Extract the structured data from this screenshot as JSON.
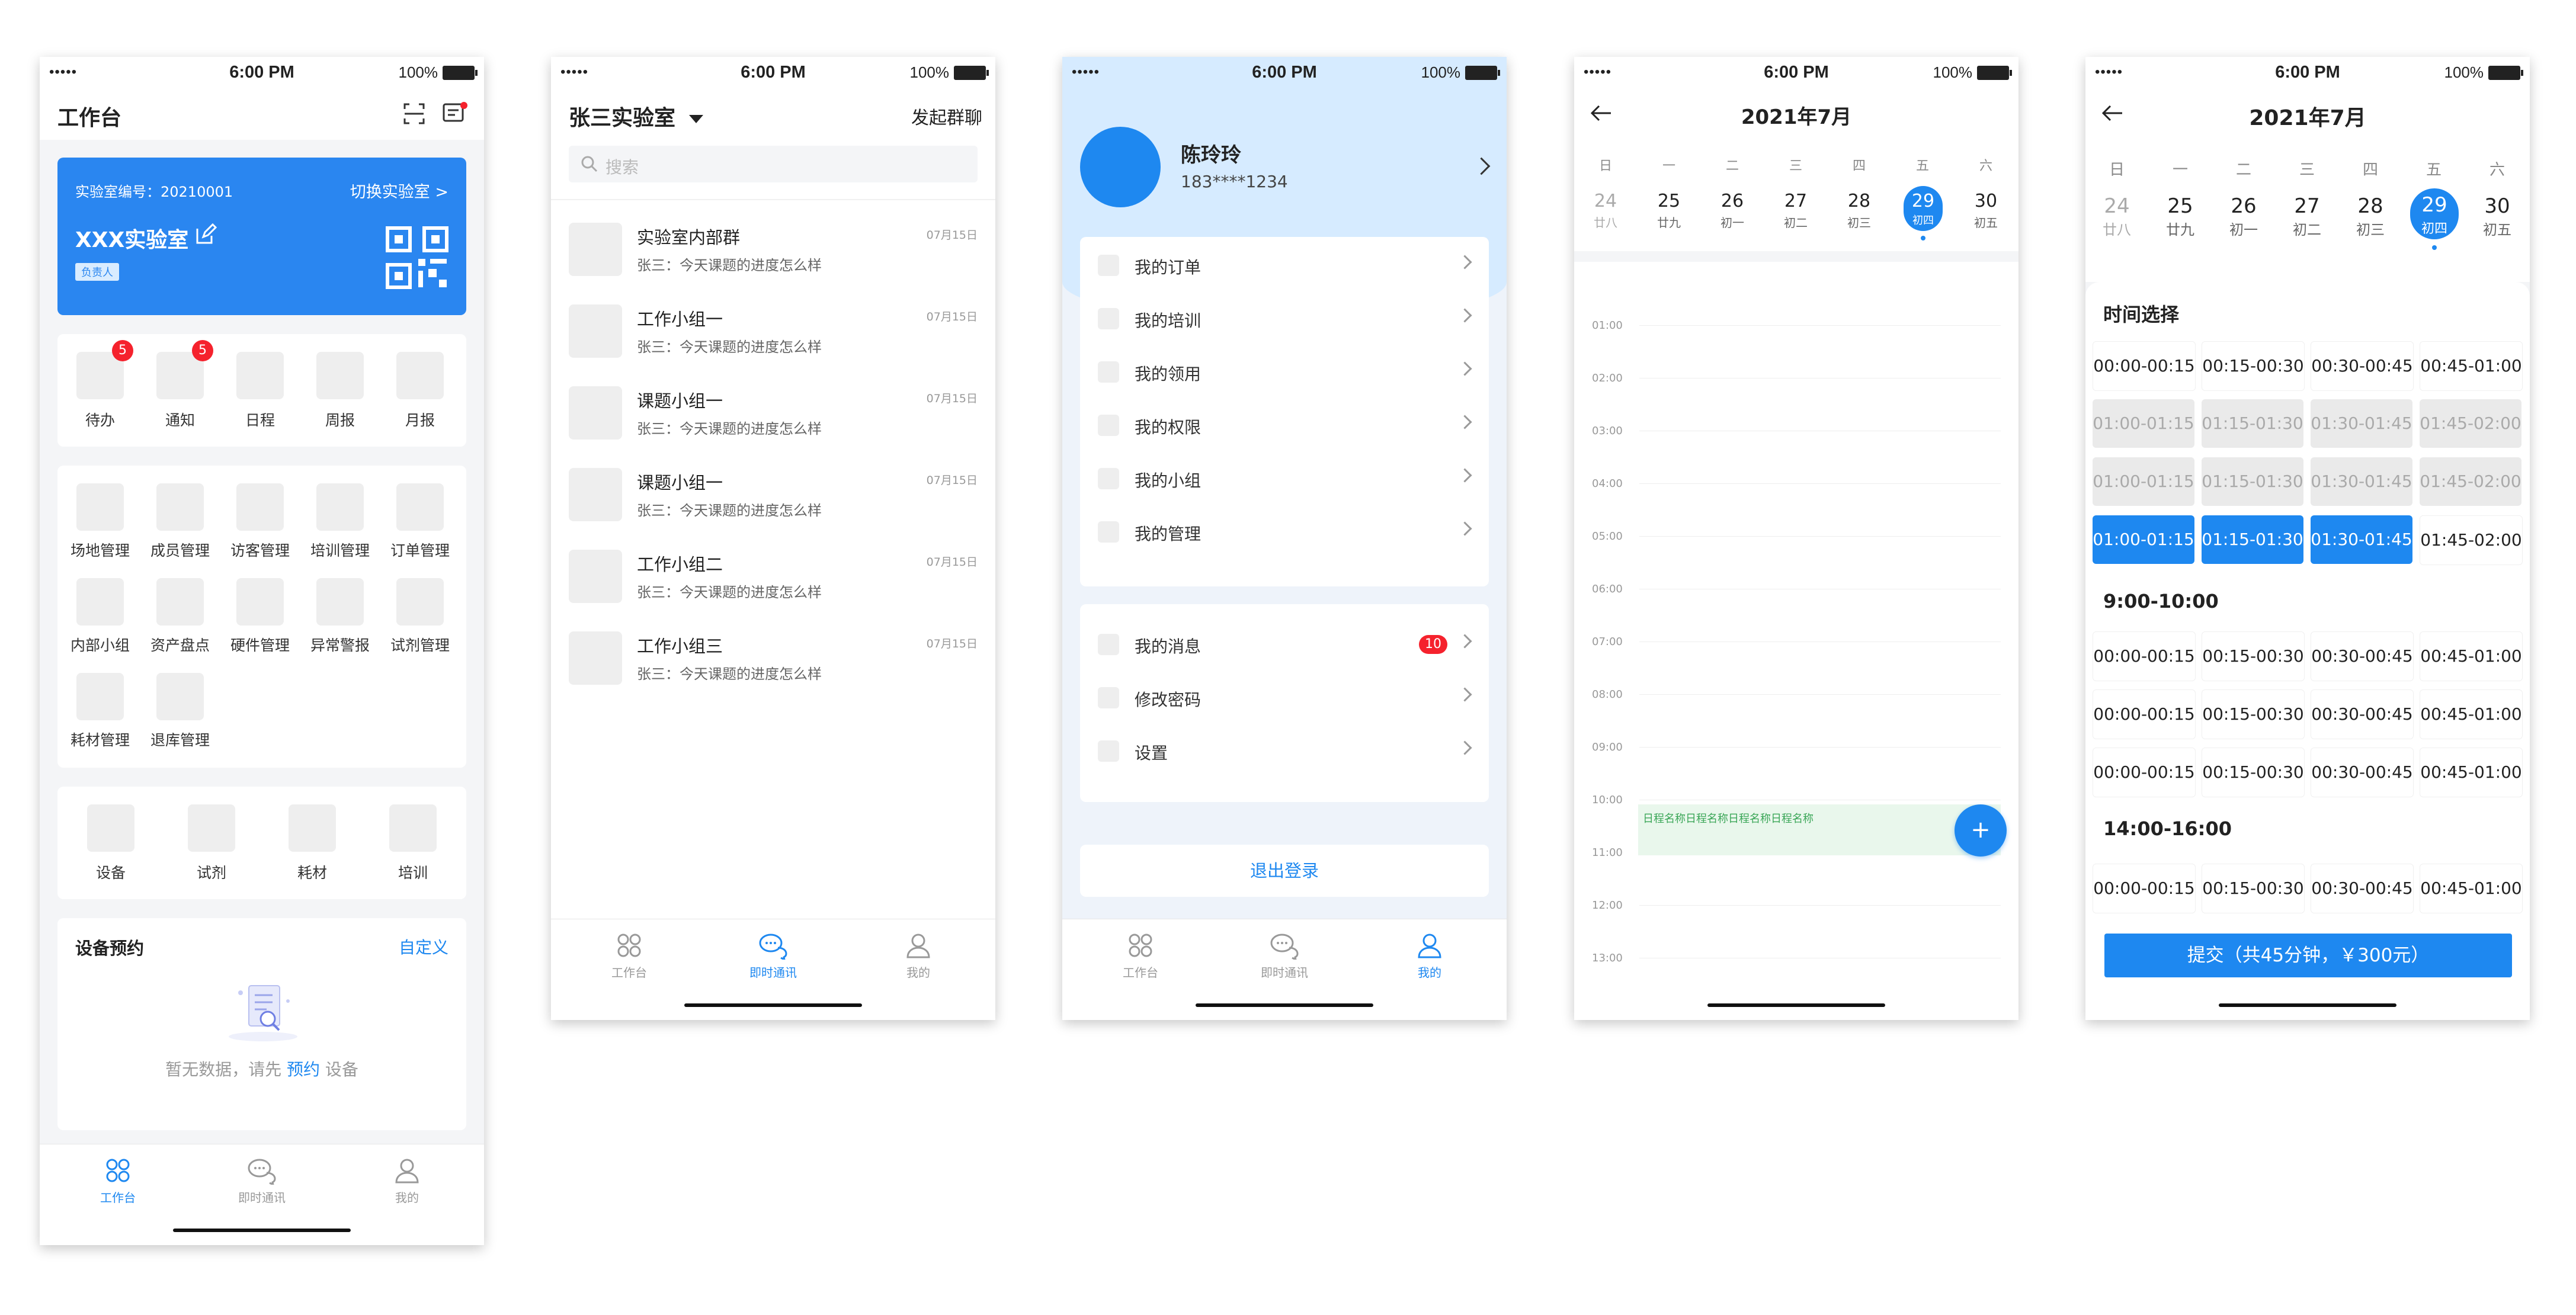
{
  "status_bar": {
    "signal": "•••••",
    "time": "6:00 PM",
    "battery": "100%"
  },
  "tabbar": [
    {
      "label": "工作台",
      "icon": "grid-icon"
    },
    {
      "label": "即时通讯",
      "icon": "chat-icon"
    },
    {
      "label": "我的",
      "icon": "user-icon"
    }
  ],
  "screen1": {
    "title": "工作台",
    "lab_card": {
      "number_label": "实验室编号：20210001",
      "switch": "切换实验室 >",
      "name": "XXX实验室",
      "role": "负责人"
    },
    "quick": [
      {
        "label": "待办",
        "badge": "5"
      },
      {
        "label": "通知",
        "badge": "5"
      },
      {
        "label": "日程",
        "badge": ""
      },
      {
        "label": "周报",
        "badge": ""
      },
      {
        "label": "月报",
        "badge": ""
      }
    ],
    "modules": [
      "场地管理",
      "成员管理",
      "访客管理",
      "培训管理",
      "订单管理",
      "内部小组",
      "资产盘点",
      "硬件管理",
      "异常警报",
      "试剂管理",
      "耗材管理",
      "退库管理"
    ],
    "resources": [
      "设备",
      "试剂",
      "耗材",
      "培训"
    ],
    "reservation": {
      "title": "设备预约",
      "customize": "自定义",
      "empty_prefix": "暂无数据，请先",
      "empty_link": "预约",
      "empty_suffix": "设备"
    }
  },
  "screen2": {
    "title": "张三实验室",
    "action": "发起群聊",
    "search_placeholder": "搜索",
    "chats": [
      {
        "name": "实验室内部群",
        "msg": "张三：今天课题的进度怎么样",
        "date": "07月15日"
      },
      {
        "name": "工作小组一",
        "msg": "张三：今天课题的进度怎么样",
        "date": "07月15日"
      },
      {
        "name": "课题小组一",
        "msg": "张三：今天课题的进度怎么样",
        "date": "07月15日"
      },
      {
        "name": "课题小组一",
        "msg": "张三：今天课题的进度怎么样",
        "date": "07月15日"
      },
      {
        "name": "工作小组二",
        "msg": "张三：今天课题的进度怎么样",
        "date": "07月15日"
      },
      {
        "name": "工作小组三",
        "msg": "张三：今天课题的进度怎么样",
        "date": "07月15日"
      }
    ]
  },
  "screen3": {
    "name": "陈玲玲",
    "phone": "183****1234",
    "menu1": [
      "我的订单",
      "我的培训",
      "我的领用",
      "我的权限",
      "我的小组",
      "我的管理"
    ],
    "menu2": [
      {
        "label": "我的消息",
        "badge": "10"
      },
      {
        "label": "修改密码",
        "badge": ""
      },
      {
        "label": "设置",
        "badge": ""
      }
    ],
    "logout": "退出登录",
    "accent": "#1e88f0",
    "header_bg": "#d6ebff"
  },
  "calendar": {
    "month": "2021年7月",
    "weekdays": [
      "日",
      "一",
      "二",
      "三",
      "四",
      "五",
      "六"
    ],
    "days": [
      {
        "num": "24",
        "lunar": "廿八"
      },
      {
        "num": "25",
        "lunar": "廿九"
      },
      {
        "num": "26",
        "lunar": "初一"
      },
      {
        "num": "27",
        "lunar": "初二"
      },
      {
        "num": "28",
        "lunar": "初三"
      },
      {
        "num": "29",
        "lunar": "初四"
      },
      {
        "num": "30",
        "lunar": "初五"
      }
    ]
  },
  "screen4": {
    "hours": [
      "01:00",
      "02:00",
      "03:00",
      "04:00",
      "05:00",
      "06:00",
      "07:00",
      "08:00",
      "09:00",
      "10:00",
      "11:00",
      "12:00",
      "13:00"
    ],
    "event": "日程名称日程名称日程名称日程名称",
    "add": "+"
  },
  "screen5": {
    "section_title": "时间选择",
    "rows1": [
      {
        "state": "n",
        "slots": [
          "00:00-00:15",
          "00:15-00:30",
          "00:30-00:45",
          "00:45-01:00"
        ]
      },
      {
        "state": "d",
        "slots": [
          "01:00-01:15",
          "01:15-01:30",
          "01:30-01:45",
          "01:45-02:00"
        ]
      },
      {
        "state": "d",
        "slots": [
          "01:00-01:15",
          "01:15-01:30",
          "01:30-01:45",
          "01:45-02:00"
        ]
      },
      {
        "state": "s",
        "slots": [
          "01:00-01:15",
          "01:15-01:30",
          "01:30-01:45",
          "01:45-02:00"
        ]
      }
    ],
    "group2_title": "9:00-10:00",
    "rows2": [
      [
        "00:00-00:15",
        "00:15-00:30",
        "00:30-00:45",
        "00:45-01:00"
      ],
      [
        "00:00-00:15",
        "00:15-00:30",
        "00:30-00:45",
        "00:45-01:00"
      ],
      [
        "00:00-00:15",
        "00:15-00:30",
        "00:30-00:45",
        "00:45-01:00"
      ]
    ],
    "group3_title": "14:00-16:00",
    "rows3": [
      [
        "00:00-00:15",
        "00:15-00:30",
        "00:30-00:45",
        "00:45-01:00"
      ]
    ],
    "submit": "提交（共45分钟，￥300元）"
  }
}
